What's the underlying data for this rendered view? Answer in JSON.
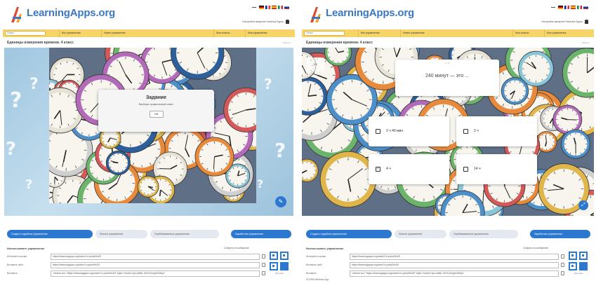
{
  "brand": {
    "name": "LearningApps.org",
    "accent": "#2c78d1",
    "nav_bg": "#f6d467"
  },
  "screens": [
    {
      "user_line": "Настройки аккаунта Наталья Бурко",
      "search_placeholder": "Поиск",
      "nav": [
        "Все упражнения",
        "Новое упражнение",
        "Мои классы",
        "Мои упражнения"
      ],
      "title": "Единицы измерения времени. 4 класс",
      "title_right": "2021-07",
      "dialog": {
        "title": "Задание",
        "text": "Выбери правильный ответ",
        "ok": "ОК"
      },
      "fab_icon": "pencil-icon",
      "actions": {
        "primary_left": "Создать подобное упражнение",
        "second": "Личное упражнение",
        "third": "Опубликованные упражнения",
        "primary_right": "Заработать упражнение"
      },
      "embed": {
        "title": "Использовать упражнение",
        "right": "Собрать в сообщение",
        "rows": [
          {
            "label": "Интернет-ссылка",
            "value": "https://learningapps.org/watch?v=pnbd3h42f"
          },
          {
            "label": "Вставить сайт",
            "value": "https://learningapps.org/view?v=pnbd3h42f"
          },
          {
            "label": "Вставить",
            "value": "<iframe src=\"https://learningapps.org/watch?v=pnbd3h42f\" style=\"border:0px;width:100%;height:500px\""
          }
        ],
        "qr_label": "QR-code"
      }
    },
    {
      "user_line": "Настройки аккаунта Наталья Бурко",
      "search_placeholder": "Поиск",
      "nav": [
        "Все упражнения",
        "Новое упражнение",
        "Мои классы",
        "Мои упражнения"
      ],
      "title": "Единицы измерения времени. 4 класс",
      "title_right": "2021-07",
      "badge": "1/4",
      "question": {
        "number": "1 / 4",
        "text": "240 минут — это ..."
      },
      "answers": [
        {
          "label": "2 ч 40 мин",
          "checked": false
        },
        {
          "label": "2 ч",
          "checked": false
        },
        {
          "label": "4 ч",
          "checked": true
        },
        {
          "label": "14 ч",
          "checked": false
        }
      ],
      "fab_icon": "fullscreen-icon",
      "actions": {
        "primary_left": "Создать подобное упражнение",
        "second": "Личное упражнение",
        "third": "Опубликованные упражнения",
        "primary_right": "Заработать упражнение"
      },
      "embed": {
        "title": "Использовать упражнение",
        "right": "Собрать в сообщение",
        "rows": [
          {
            "label": "Интернет-ссылка",
            "value": "https://learningapps.org/watch?v=pnbd3h42f"
          },
          {
            "label": "Вставить сайт",
            "value": "https://learningapps.org/view?v=pnbd3h42f"
          },
          {
            "label": "Вставить",
            "value": "<iframe src=\"https://learningapps.org/watch?v=pnbd3h42f\" style=\"border:0px;width:100%;height:500px\""
          }
        ],
        "footer": "SCORM  Windows-App",
        "qr_label": "QR-code"
      }
    }
  ]
}
